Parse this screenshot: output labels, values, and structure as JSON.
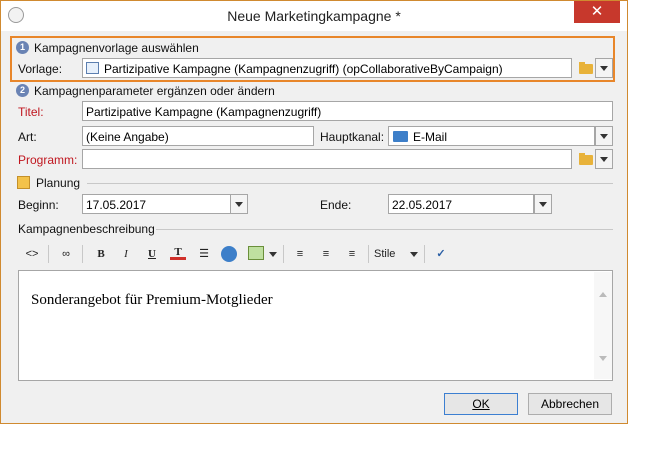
{
  "window": {
    "title": "Neue Marketingkampagne *",
    "close_glyph": "✕"
  },
  "section1": {
    "number": "1",
    "heading": "Kampagnenvorlage auswählen",
    "vorlage_label": "Vorlage:",
    "vorlage_value": "Partizipative Kampagne (Kampagnenzugriff) (opCollaborativeByCampaign)"
  },
  "section2": {
    "number": "2",
    "heading": "Kampagnenparameter ergänzen oder ändern",
    "titel_label": "Titel:",
    "titel_value": "Partizipative Kampagne (Kampagnenzugriff)",
    "art_label": "Art:",
    "art_value": "(Keine Angabe)",
    "hauptkanal_label": "Hauptkanal:",
    "hauptkanal_value": "E-Mail",
    "programm_label": "Programm:",
    "programm_value": ""
  },
  "planung": {
    "heading": "Planung",
    "beginn_label": "Beginn:",
    "beginn_value": "17.05.2017",
    "ende_label": "Ende:",
    "ende_value": "22.05.2017"
  },
  "beschreibung": {
    "heading": "Kampagnenbeschreibung",
    "toolbar": {
      "bold": "B",
      "italic": "I",
      "underline": "U",
      "style_label": "Stile"
    },
    "content": "Sonderangebot für Premium-Motglieder"
  },
  "buttons": {
    "ok": "OK",
    "cancel": "Abbrechen"
  },
  "colors": {
    "highlight_border": "#e8862a",
    "required_label": "#c0161f",
    "step_badge": "#6a83b4",
    "close_button": "#c7382c"
  },
  "icons": [
    "app-icon",
    "close-icon",
    "template-icon",
    "folder-icon",
    "email-icon",
    "calendar-icon",
    "source-toggle-icon",
    "find-icon",
    "font-color-icon",
    "list-icon",
    "link-icon",
    "image-icon",
    "align-left-icon",
    "align-center-icon",
    "align-right-icon",
    "spellcheck-icon"
  ]
}
